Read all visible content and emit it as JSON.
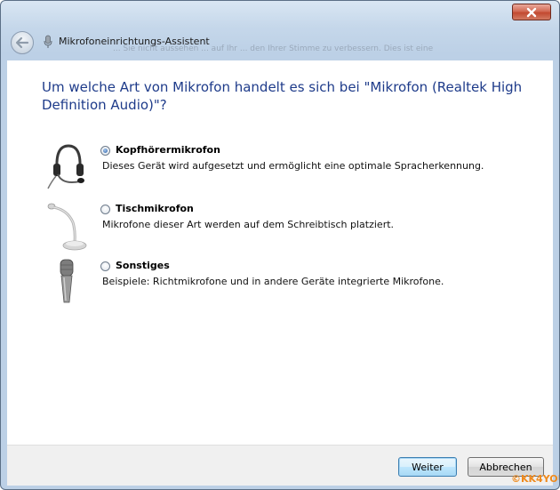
{
  "window": {
    "title": "Mikrofoneinrichtungs-Assistent",
    "background_text": "... Sie nicht aussehen ... auf Ihr ... den Ihrer Stimme zu verbessern. Dies ist eine"
  },
  "heading": "Um welche Art von Mikrofon handelt es sich bei \"Mikrofon (Realtek High Definition Audio)\"?",
  "options": [
    {
      "label": "Kopfhörermikrofon",
      "description": "Dieses Gerät wird aufgesetzt und ermöglicht eine optimale Spracherkennung.",
      "checked": true,
      "icon": "headset-icon"
    },
    {
      "label": "Tischmikrofon",
      "description": "Mikrofone dieser Art werden auf dem Schreibtisch platziert.",
      "checked": false,
      "icon": "desk-microphone-icon"
    },
    {
      "label": "Sonstiges",
      "description": "Beispiele: Richtmikrofone und in andere Geräte integrierte Mikrofone.",
      "checked": false,
      "icon": "handheld-microphone-icon"
    }
  ],
  "buttons": {
    "next": "Weiter",
    "cancel": "Abbrechen"
  },
  "watermark": "©KK4YOU",
  "colors": {
    "heading": "#1e3b8a",
    "close_button": "#c24930",
    "default_button_border": "#3c7fb1",
    "watermark": "#f08a1c"
  }
}
